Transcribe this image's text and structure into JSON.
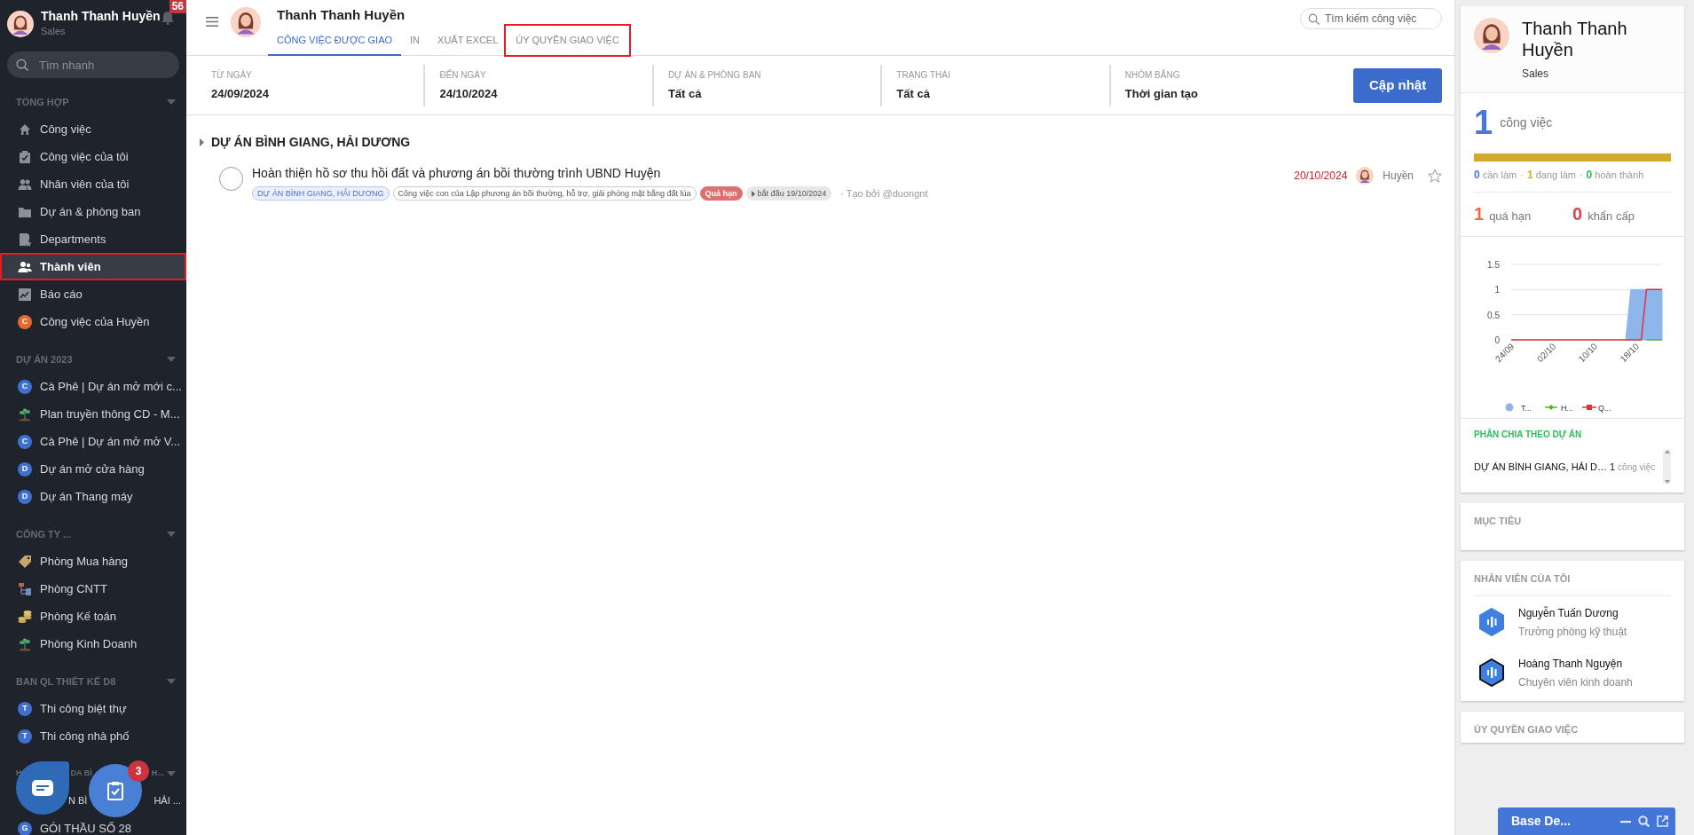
{
  "sidebar": {
    "user": {
      "name": "Thanh Thanh Huyền",
      "role": "Sales",
      "notifications": "56"
    },
    "search": {
      "placeholder": "Tìm nhanh"
    },
    "sections": [
      {
        "title": "TỔNG HỢP",
        "items": [
          {
            "label": "Công việc",
            "kind": "icon",
            "selected": false,
            "highlighted": false
          },
          {
            "label": "Công việc của tôi",
            "kind": "icon",
            "selected": false,
            "highlighted": false
          },
          {
            "label": "Nhân viên của tôi",
            "kind": "icon",
            "selected": false,
            "highlighted": false
          },
          {
            "label": "Dự án & phòng ban",
            "kind": "icon",
            "selected": false,
            "highlighted": false
          },
          {
            "label": "Departments",
            "kind": "icon",
            "selected": false,
            "highlighted": false
          },
          {
            "label": "Thành viên",
            "kind": "icon",
            "selected": true,
            "highlighted": true
          },
          {
            "label": "Báo cáo",
            "kind": "icon",
            "selected": false,
            "highlighted": false
          },
          {
            "label": "Công việc của Huyền",
            "kind": "letter",
            "letter": "C",
            "color": "#e8672c",
            "selected": false,
            "highlighted": false
          }
        ]
      },
      {
        "title": "DỰ ÁN 2023",
        "items": [
          {
            "label": "Cà Phê | Dự án mở mới c...",
            "kind": "letter",
            "letter": "C",
            "color": "#3f6fd1",
            "selected": false,
            "highlighted": false
          },
          {
            "label": "Plan truyền thông CD - M...",
            "kind": "icon",
            "selected": false,
            "highlighted": false
          },
          {
            "label": "Cà Phê | Dự án mở mở V...",
            "kind": "letter",
            "letter": "C",
            "color": "#3f6fd1",
            "selected": false,
            "highlighted": false
          },
          {
            "label": "Dự án mở cửa hàng",
            "kind": "letter",
            "letter": "D",
            "color": "#3f6fd1",
            "selected": false,
            "highlighted": false
          },
          {
            "label": "Dự án Thang máy",
            "kind": "letter",
            "letter": "D",
            "color": "#3f6fd1",
            "selected": false,
            "highlighted": false
          }
        ]
      },
      {
        "title": "CÔNG TY ...",
        "items": [
          {
            "label": "Phòng Mua hàng",
            "kind": "icon",
            "selected": false,
            "highlighted": false
          },
          {
            "label": "Phòng CNTT",
            "kind": "icon",
            "selected": false,
            "highlighted": false
          },
          {
            "label": "Phòng Kế toán",
            "kind": "icon",
            "selected": false,
            "highlighted": false
          },
          {
            "label": "Phòng Kinh Doanh",
            "kind": "icon",
            "selected": false,
            "highlighted": false
          }
        ]
      },
      {
        "title": "BAN QL THIẾT KẾ D8",
        "items": [
          {
            "label": "Thi công biệt thự",
            "kind": "letter",
            "letter": "T",
            "color": "#3f6fd1",
            "selected": false,
            "highlighted": false
          },
          {
            "label": "Thi công nhà phố",
            "kind": "letter",
            "letter": "T",
            "color": "#3f6fd1",
            "selected": false,
            "highlighted": false
          }
        ]
      },
      {
        "title_fragments": [
          "H",
          "DA BÌ",
          "H..."
        ],
        "items": [
          {
            "label_fragments": [
              "N BÌ",
              "HẢI ..."
            ],
            "kind": "hidden",
            "selected": false,
            "highlighted": false
          },
          {
            "label": "GÓI THẦU SỐ 28",
            "kind": "letter",
            "letter": "G",
            "color": "#3f6fd1",
            "selected": false,
            "highlighted": false
          }
        ]
      }
    ]
  },
  "floating_buttons": [
    {
      "kind": "chat"
    },
    {
      "kind": "tasks",
      "badge": "3"
    }
  ],
  "header": {
    "name": "Thanh Thanh Huyền",
    "tabs": [
      {
        "label": "CÔNG VIỆC ĐƯỢC GIAO",
        "selected": true,
        "highlighted": false
      },
      {
        "label": "IN",
        "selected": false,
        "highlighted": false
      },
      {
        "label": "XUẤT EXCEL",
        "selected": false,
        "highlighted": false
      },
      {
        "label": "ỦY QUYỀN GIAO VIỆC",
        "selected": false,
        "highlighted": true
      }
    ],
    "search": {
      "placeholder": "Tìm kiếm công việc"
    }
  },
  "filters": [
    {
      "label": "TỪ NGÀY",
      "value": "24/09/2024"
    },
    {
      "label": "ĐẾN NGÀY",
      "value": "24/10/2024"
    },
    {
      "label": "DỰ ÁN & PHÒNG BAN",
      "value": "Tất cả"
    },
    {
      "label": "TRẠNG THÁI",
      "value": "Tất cả"
    },
    {
      "label": "NHÓM BẰNG",
      "value": "Thời gian tạo"
    }
  ],
  "update_button": "Cập nhật",
  "groups": [
    {
      "title": "DỰ ÁN BÌNH GIANG, HẢI DƯƠNG",
      "tasks": [
        {
          "title": "Hoàn thiện hồ sơ thu hồi đất và phương án bồi thường trình UBND Huyện",
          "done": false,
          "starred": false,
          "tags": [
            {
              "kind": "project",
              "text": "DỰ ÁN BÌNH GIANG, HẢI DƯƠNG"
            },
            {
              "kind": "parent",
              "text": "Công việc con của Lập phương án bồi thường, hỗ trợ, giải phóng mặt bằng đất lúa"
            },
            {
              "kind": "overdue",
              "text": "Quá hạn"
            },
            {
              "kind": "start",
              "text": "bắt đầu 19/10/2024"
            }
          ],
          "creator": "· Tạo bởi @duongnt",
          "deadline": "20/10/2024",
          "assignee": "Huyền"
        }
      ]
    }
  ],
  "profile": {
    "name": "Thanh Thanh Huyền",
    "role": "Sales",
    "total": "1",
    "total_label": "công việc",
    "statuses": [
      {
        "count": "0",
        "label": "cần làm",
        "color": "#4a78d8"
      },
      {
        "count": "1",
        "label": "đang làm",
        "color": "#d4a92a"
      },
      {
        "count": "0",
        "label": "hoàn thành",
        "color": "#2ebd59"
      }
    ],
    "separator": "·",
    "alerts": [
      {
        "count": "1",
        "label": "quá hạn",
        "color": "#f06a35"
      },
      {
        "count": "0",
        "label": "khẩn cấp",
        "color": "#d9434e"
      }
    ],
    "chart_data": {
      "type": "line",
      "categories": [
        "24/09",
        null,
        null,
        null,
        null,
        null,
        null,
        null,
        "02/10",
        null,
        null,
        null,
        null,
        null,
        null,
        null,
        "10/10",
        null,
        null,
        null,
        null,
        null,
        null,
        null,
        "18/10",
        null,
        null,
        null,
        null,
        null
      ],
      "series": [
        {
          "name": "T...",
          "type": "area",
          "color": "#8fb6ea",
          "values": [
            null,
            null,
            null,
            null,
            null,
            null,
            null,
            null,
            null,
            null,
            null,
            null,
            null,
            null,
            null,
            null,
            null,
            null,
            null,
            null,
            null,
            null,
            0,
            1,
            1,
            1,
            1,
            1,
            1,
            1
          ]
        },
        {
          "name": "H...",
          "color": "#52b42c",
          "values": [
            null,
            null,
            null,
            null,
            null,
            null,
            null,
            null,
            null,
            null,
            null,
            null,
            null,
            null,
            null,
            null,
            null,
            null,
            null,
            null,
            null,
            null,
            null,
            null,
            null,
            null,
            0,
            0,
            0,
            0
          ]
        },
        {
          "name": "Q...",
          "color": "#e0303c",
          "values": [
            0,
            0,
            0,
            0,
            0,
            0,
            0,
            0,
            0,
            0,
            0,
            0,
            0,
            0,
            0,
            0,
            0,
            0,
            0,
            0,
            0,
            0,
            0,
            0,
            0,
            0,
            1,
            1,
            1,
            1
          ]
        }
      ],
      "ylim": [
        0,
        1.5
      ],
      "yticks": [
        0,
        0.5,
        1,
        1.5
      ],
      "legend": "bottom"
    },
    "by_project": {
      "title": "PHÂN CHIA THEO DỰ ÁN",
      "rows": [
        {
          "name": "DỰ ÁN BÌNH GIANG, HẢI D…",
          "count": "1",
          "unit": "công việc"
        }
      ]
    }
  },
  "goals": {
    "title": "MỤC TIÊU"
  },
  "staff": {
    "title": "NHÂN VIÊN CỦA TÔI",
    "people": [
      {
        "name": "Nguyễn Tuấn Dương",
        "role": "Trưởng phòng kỹ thuật"
      },
      {
        "name": "Hoàng Thanh Nguyện",
        "role": "Chuyên viên kinh doanh"
      }
    ]
  },
  "delegation": {
    "title": "ỦY QUYỀN GIAO VIỆC"
  },
  "chat_bar": {
    "title": "Base De..."
  }
}
